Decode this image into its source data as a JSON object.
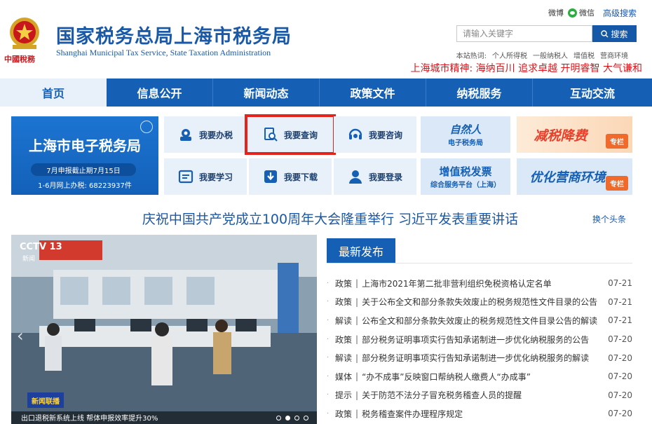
{
  "header": {
    "logo_text": "中國稅務",
    "title": "国家税务总局上海市税务局",
    "title_en": "Shanghai Municipal Tax Service, State Taxation Administration",
    "weibo": "微博",
    "weixin": "微信",
    "advanced_search": "高级搜索",
    "search_placeholder": "请输入关键字",
    "search_button": "搜索",
    "hot_label": "本站热词:",
    "hot_words": [
      "个人所得税",
      "一般纳税人",
      "增值税",
      "营商环境"
    ],
    "spirit": "上海城市精神:  海纳百川 追求卓越 开明睿智 大气谦和"
  },
  "nav": {
    "items": [
      {
        "label": "首页",
        "active": true
      },
      {
        "label": "信息公开"
      },
      {
        "label": "新闻动态"
      },
      {
        "label": "政策文件"
      },
      {
        "label": "纳税服务"
      },
      {
        "label": "互动交流"
      }
    ]
  },
  "services": {
    "etax_title": "上海市电子税务局",
    "etax_note1": "7月申报截止期7月15日",
    "etax_note2": "1-6月网上办税: 68223937件",
    "items": [
      {
        "label": "我要办税",
        "icon": "handle-tax-icon"
      },
      {
        "label": "我要查询",
        "icon": "query-icon",
        "highlighted": true
      },
      {
        "label": "我要咨询",
        "icon": "consult-icon"
      },
      {
        "label": "我要学习",
        "icon": "study-icon"
      },
      {
        "label": "我要下载",
        "icon": "download-icon"
      },
      {
        "label": "我要登录",
        "icon": "login-icon"
      }
    ],
    "promos": {
      "natural_title": "自然人",
      "natural_sub": "电子税务局",
      "tax_cut": "减税降费",
      "tax_cut_tag": "专栏",
      "vat_title": "增值税发票",
      "vat_sub": "综合服务平台（上海）",
      "biz_env": "优化营商环境",
      "biz_env_tag": "专栏"
    }
  },
  "headline": {
    "text": "庆祝中国共产党成立100周年大会隆重举行 习近平发表重要讲话",
    "more": "换个头条"
  },
  "carousel": {
    "cctv": "CCTV 13",
    "cctv_sub": "新闻",
    "news_logo": "新闻联播",
    "caption": "出口退税新系统上线 帮体申报效率提升30%",
    "active_index": 1,
    "count": 4
  },
  "news": {
    "tab": "最新发布",
    "items": [
      {
        "cat": "政策",
        "title": "上海市2021年第二批非营利组织免税资格认定名单",
        "date": "07-21"
      },
      {
        "cat": "政策",
        "title": "关于公布全文和部分条款失效废止的税务规范性文件目录的公告",
        "date": "07-21"
      },
      {
        "cat": "解读",
        "title": "公布全文和部分条款失效废止的税务规范性文件目录公告的解读",
        "date": "07-21"
      },
      {
        "cat": "政策",
        "title": "部分税务证明事项实行告知承诺制进一步优化纳税服务的公告",
        "date": "07-20"
      },
      {
        "cat": "解读",
        "title": "部分税务证明事项实行告知承诺制进一步优化纳税服务的解读",
        "date": "07-20"
      },
      {
        "cat": "媒体",
        "title": "“办不成事”反映窗口帮纳税人缴费人“办成事”",
        "date": "07-20"
      },
      {
        "cat": "提示",
        "title": "关于防范不法分子冒充税务稽查人员的提醒",
        "date": "07-20"
      },
      {
        "cat": "政策",
        "title": "税务稽查案件办理程序规定",
        "date": "07-20"
      }
    ]
  },
  "colors": {
    "brand_blue": "#1560b5",
    "title_blue": "#1a58a8",
    "accent_red": "#d4161c",
    "highlight_red": "#e5231d"
  }
}
